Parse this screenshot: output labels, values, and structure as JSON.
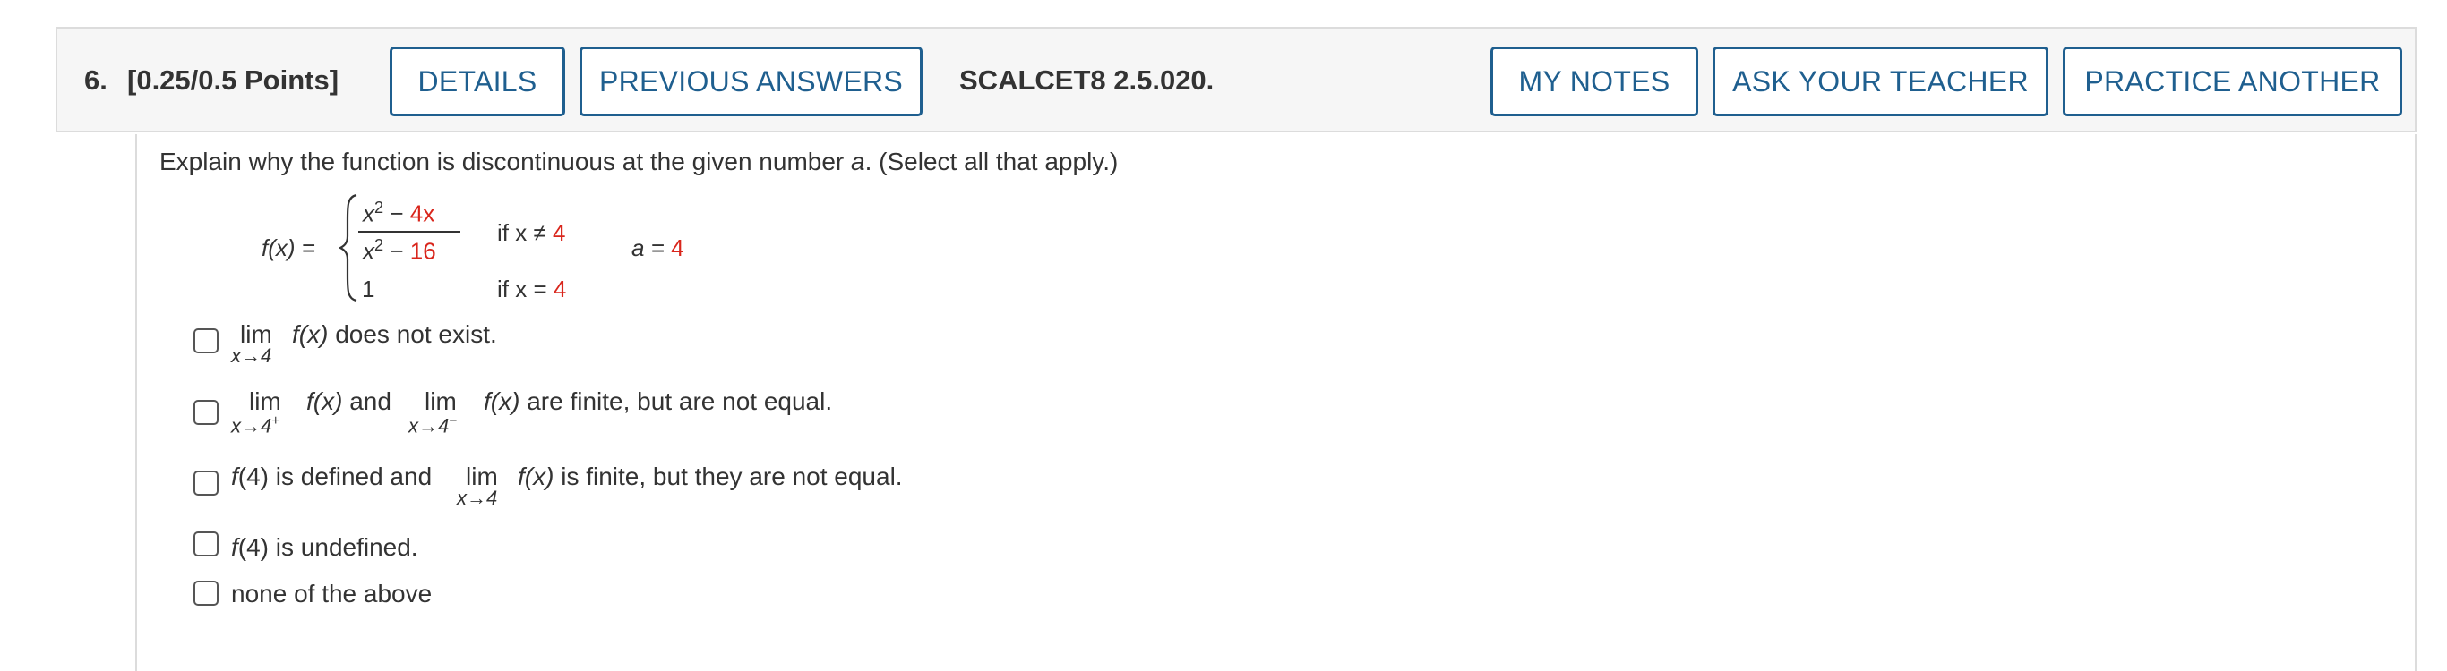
{
  "header": {
    "number": "6.",
    "points": "[0.25/0.5 Points]",
    "details_label": "DETAILS",
    "previous_label": "PREVIOUS ANSWERS",
    "code": "SCALCET8 2.5.020.",
    "notes_label": "MY NOTES",
    "ask_label": "ASK YOUR TEACHER",
    "practice_label": "PRACTICE ANOTHER"
  },
  "question": {
    "prompt_a": "Explain why the function is discontinuous at the given number ",
    "prompt_var": "a",
    "prompt_b": ". (Select all that apply.)"
  },
  "function": {
    "lhs": "f(x) =",
    "num_a": "x",
    "num_exp": "2",
    "num_b": " − ",
    "num_red": "4x",
    "den_a": "x",
    "den_exp": "2",
    "den_b": " − ",
    "den_red": "16",
    "cond1_a": "if x ≠ ",
    "cond1_red": "4",
    "case2_value": "1",
    "cond2_a": "if x = ",
    "cond2_red": "4",
    "a_label": "a = ",
    "a_value": "4"
  },
  "options": {
    "opt1": {
      "lim": "lim",
      "sub": "x→4",
      "expr": "f(x)",
      "text": " does not exist."
    },
    "opt2": {
      "lim1": "lim",
      "sub1": "x→4",
      "sup1": "+",
      "expr1": "f(x)",
      "and": " and ",
      "lim2": "lim",
      "sub2": "x→4",
      "sup2": "−",
      "expr2": "f(x)",
      "text": " are finite, but are not equal."
    },
    "opt3": {
      "pre_f": "f",
      "pre_arg": "(4)",
      "pre_text": " is defined and ",
      "lim": "lim",
      "sub": "x→4",
      "expr": "f(x)",
      "text": " is finite, but they are not equal."
    },
    "opt4": {
      "f": "f",
      "arg": "(4)",
      "text": " is undefined."
    },
    "opt5": {
      "text": "none of the above"
    }
  },
  "colors": {
    "accent": "#1f5f8f",
    "highlight": "#d9261c",
    "border": "#dcdcdc",
    "header_bg": "#f6f6f6"
  }
}
